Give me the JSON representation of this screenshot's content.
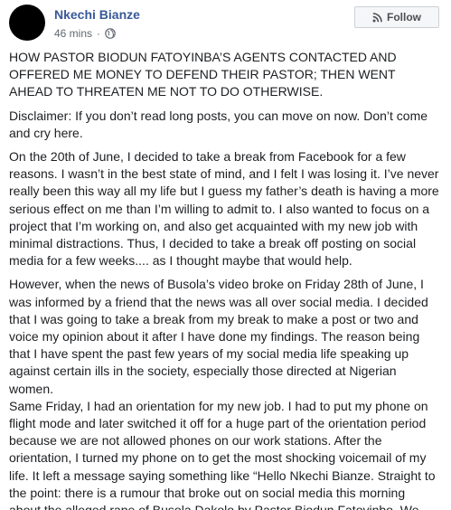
{
  "post": {
    "author": "Nkechi Bianze",
    "time": "46 mins",
    "separator": "·",
    "privacy_icon": "globe-icon",
    "follow_label": "Follow",
    "follow_icon": "rss-icon",
    "paragraphs": [
      [
        "HOW PASTOR BIODUN FATOYINBA’S AGENTS CONTACTED AND",
        "OFFERED ME MONEY TO DEFEND THEIR PASTOR; THEN WENT",
        "AHEAD TO THREATEN ME NOT TO DO OTHERWISE."
      ],
      [
        "Disclaimer: If you don’t read long posts, you can move on now. Don’t come",
        "and cry here."
      ],
      [
        "On the 20th of June, I decided to take a break from Facebook for a few",
        "reasons. I wasn’t in the best state of mind, and I felt I was losing it. I’ve never",
        "really been this way all my life but I guess my father’s death is having a more",
        "serious effect on me than I’m willing to admit to. I also wanted to focus on a",
        "project that I’m working on, and also get acquainted with my new job with",
        "minimal distractions. Thus, I decided to take a break off posting on social",
        "media for a few weeks.... as I thought maybe that would help."
      ],
      [
        "However, when the news of Busola’s video broke on Friday 28th of June, I",
        "was informed by a friend that the news was all over social media. I decided",
        "that I was going to take a break from my break to make a post or two and",
        "voice my opinion about it after I have done my findings. The reason being",
        "that I have spent the past few years of my social media life speaking up",
        "against certain ills in the society, especially those directed at Nigerian",
        "women.",
        "Same Friday, I had an orientation for my new job. I had to put my phone on",
        "flight mode and later switched it off for a huge part of the orientation period",
        "because we are not allowed phones on our work stations. After the",
        "orientation, I turned my phone on to get the most shocking voicemail of my",
        "life. It left a message saying something like “Hello Nkechi Bianze. Straight to",
        "the point: there is a rumour that broke out on social media this morning",
        "about the alleged rape of Busola Dakolo by Pastor Biodun Fatoyinbo. We"
      ]
    ]
  }
}
